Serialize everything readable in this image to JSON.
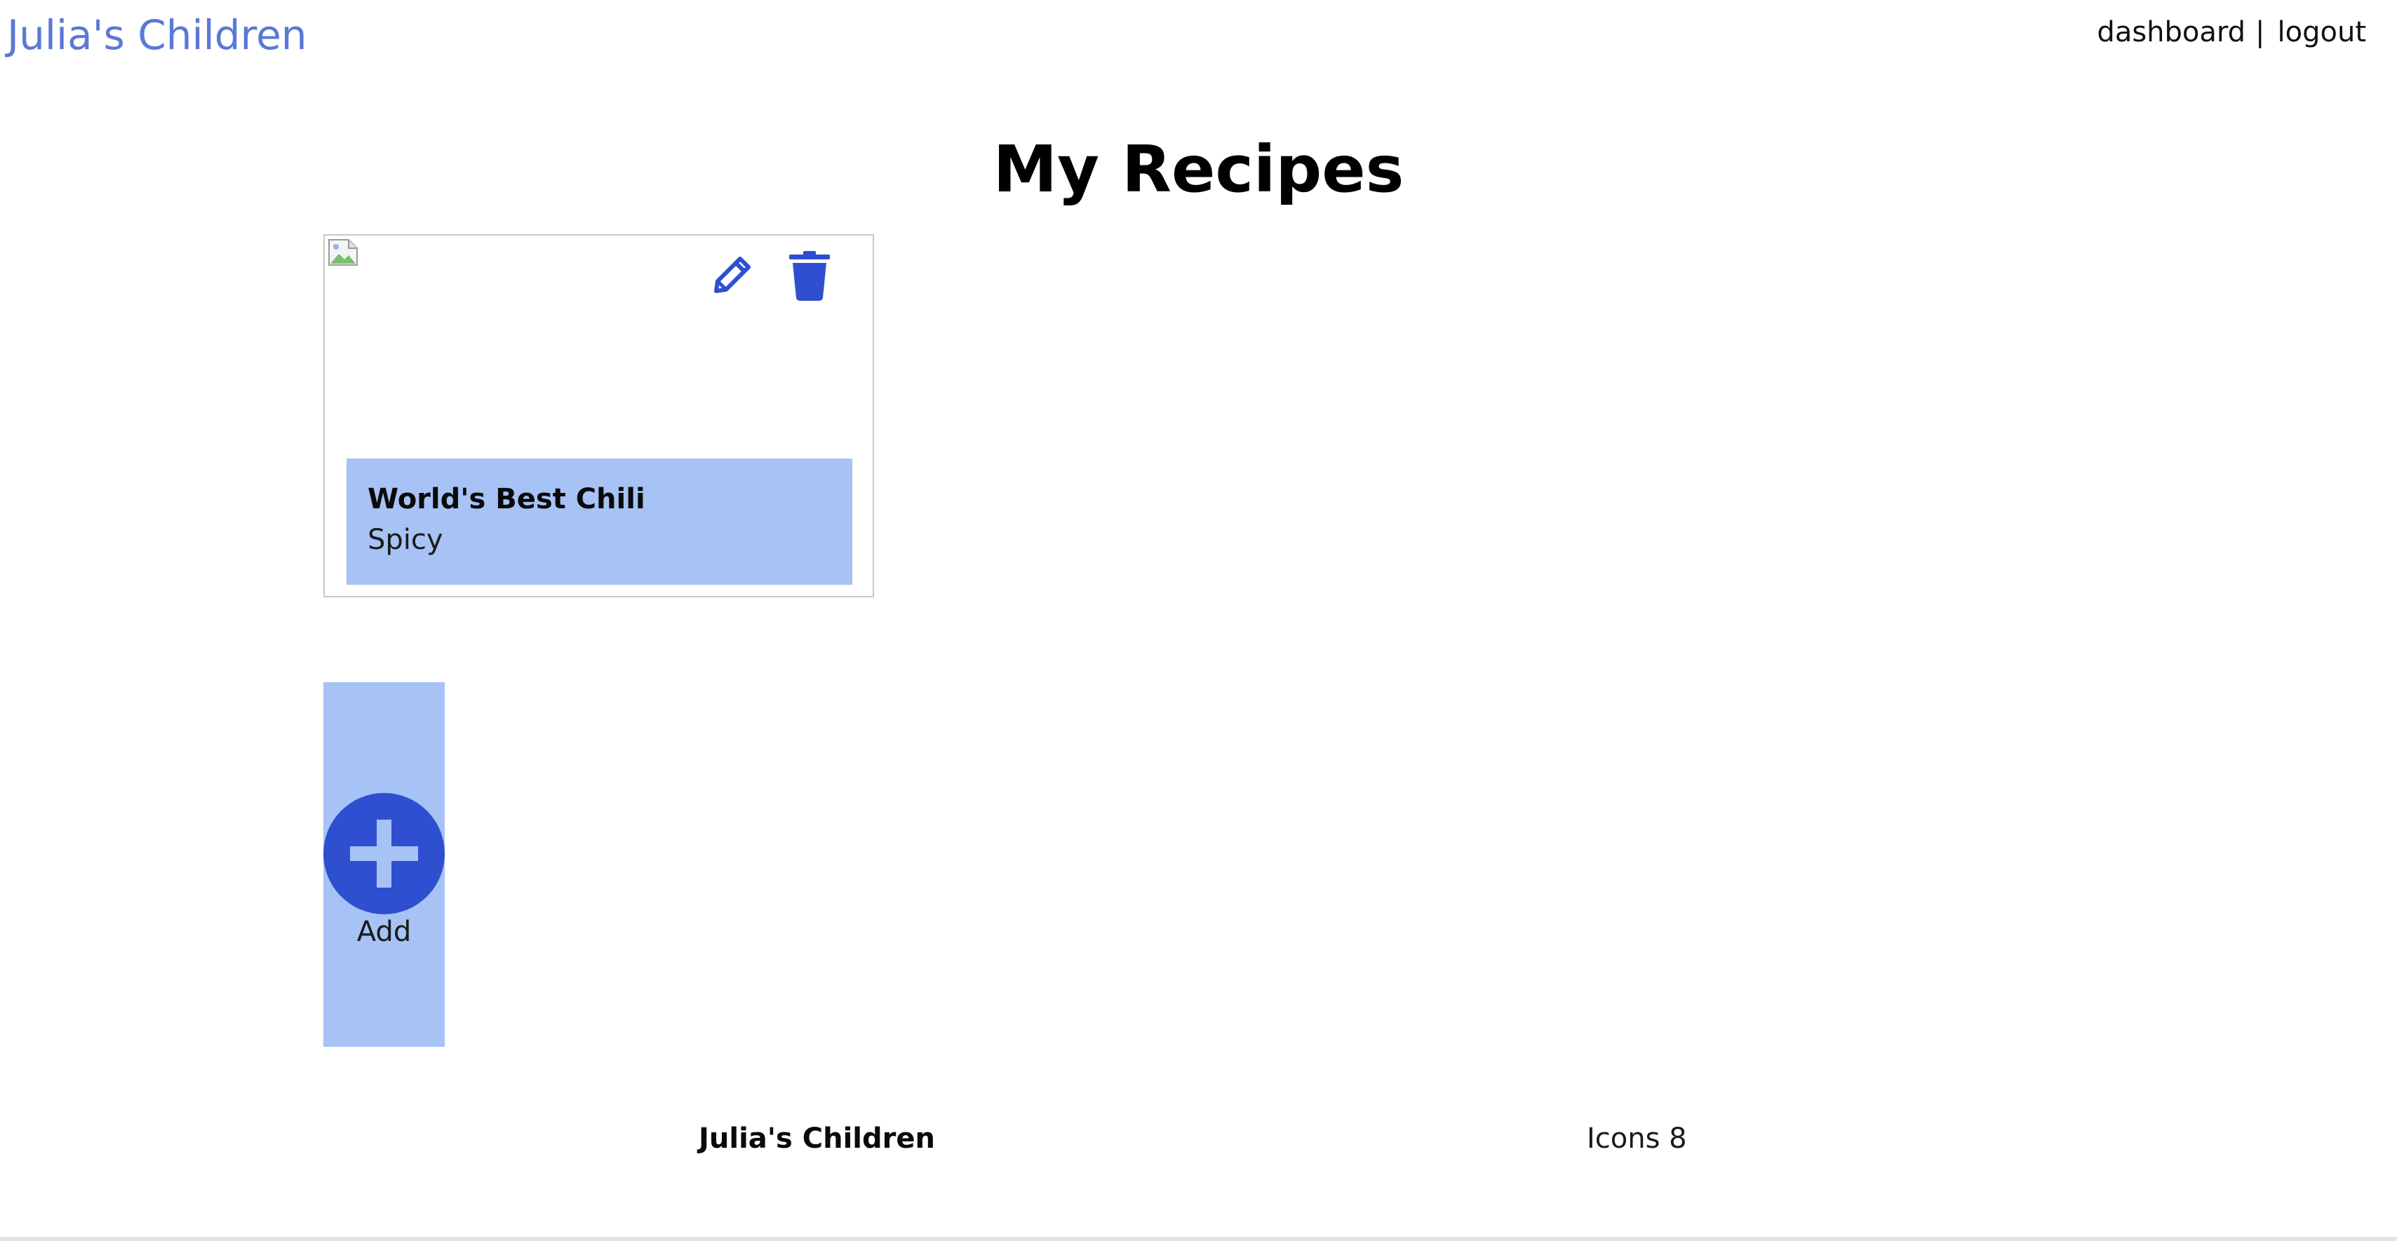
{
  "header": {
    "brand": "Julia's Children",
    "nav": {
      "dashboard": "dashboard",
      "separator": "|",
      "logout": "logout"
    }
  },
  "main": {
    "title": "My Recipes",
    "recipes": [
      {
        "name": "World's Best Chili",
        "description": "Spicy",
        "icons": [
          "broken-image-icon",
          "pencil-icon",
          "trash-icon"
        ]
      }
    ],
    "add": {
      "label": "Add",
      "icon": "plus-circle-icon"
    }
  },
  "footer": {
    "brand": "Julia's Children",
    "credit": "Icons 8"
  },
  "colors": {
    "brand_link": "#5a78d6",
    "accent": "#2d4fd0",
    "card_fill": "#a7c2f5",
    "card_border": "#c9c9c9"
  }
}
